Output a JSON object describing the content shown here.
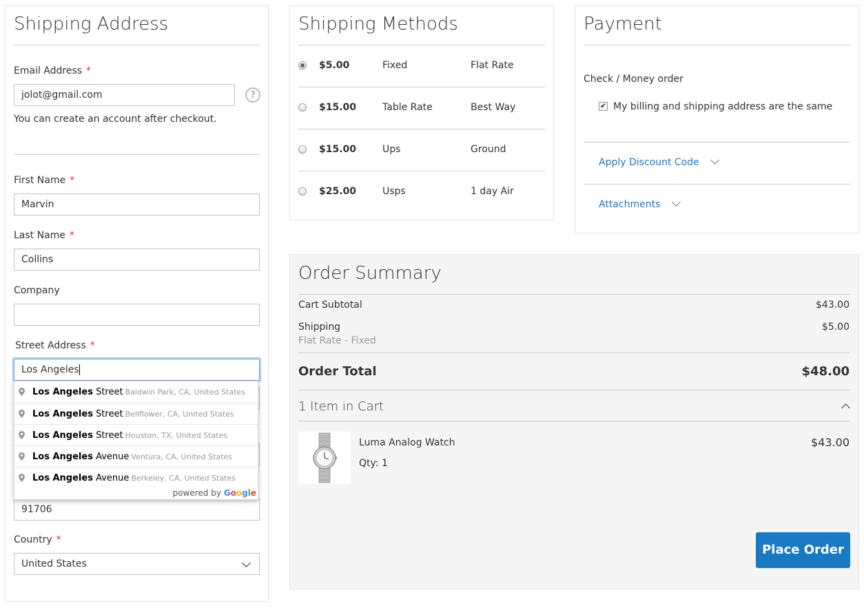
{
  "shipping_address": {
    "title": "Shipping Address",
    "email_label": "Email Address",
    "email_value": "jolot@gmail.com",
    "account_note": "You can create an account after checkout.",
    "first_name_label": "First Name",
    "first_name_value": "Marvin",
    "last_name_label": "Last Name",
    "last_name_value": "Collins",
    "company_label": "Company",
    "company_value": "",
    "street_label": "Street Address",
    "street_value": "Los Angeles",
    "zip_value": "91706",
    "country_label": "Country",
    "country_value": "United States",
    "required_mark": "*",
    "help_glyph": "?"
  },
  "autocomplete": {
    "items": [
      {
        "match": "Los Angeles",
        "rest": "Street",
        "secondary": "Baldwin Park, CA, United States"
      },
      {
        "match": "Los Angeles",
        "rest": "Street",
        "secondary": "Bellflower, CA, United States"
      },
      {
        "match": "Los Angeles",
        "rest": "Street",
        "secondary": "Houston, TX, United States"
      },
      {
        "match": "Los Angeles",
        "rest": "Avenue",
        "secondary": "Ventura, CA, United States"
      },
      {
        "match": "Los Angeles",
        "rest": "Avenue",
        "secondary": "Berkeley, CA, United States"
      }
    ],
    "powered_by": "powered by",
    "google": [
      "G",
      "o",
      "o",
      "g",
      "l",
      "e"
    ],
    "google_colors": [
      "#4285F4",
      "#EA4335",
      "#FBBC05",
      "#4285F4",
      "#34A853",
      "#EA4335"
    ]
  },
  "shipping_methods": {
    "title": "Shipping Methods",
    "rows": [
      {
        "price": "$5.00",
        "method": "Fixed",
        "carrier": "Flat Rate"
      },
      {
        "price": "$15.00",
        "method": "Table Rate",
        "carrier": "Best Way"
      },
      {
        "price": "$15.00",
        "method": "Ups",
        "carrier": "Ground"
      },
      {
        "price": "$25.00",
        "method": "Usps",
        "carrier": "1 day Air"
      }
    ]
  },
  "payment": {
    "title": "Payment",
    "method": "Check / Money order",
    "same_address_label": "My billing and shipping address are the same",
    "discount_label": "Apply Discount Code",
    "attachments_label": "Attachments"
  },
  "order_summary": {
    "title": "Order Summary",
    "subtotal_label": "Cart Subtotal",
    "subtotal_value": "$43.00",
    "shipping_label": "Shipping",
    "shipping_value": "$5.00",
    "shipping_method": "Flat Rate - Fixed",
    "total_label": "Order Total",
    "total_value": "$48.00",
    "items_in_cart": "1 Item in Cart",
    "item_name": "Luma Analog Watch",
    "item_qty": "Qty: 1",
    "item_price": "$43.00",
    "place_order_label": "Place Order"
  },
  "colors": {
    "accent": "#1979c3",
    "required": "#e02b27",
    "focus": "#68a8e0"
  }
}
